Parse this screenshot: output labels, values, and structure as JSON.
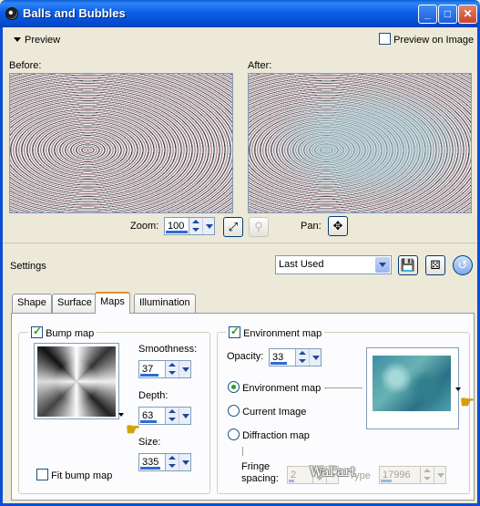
{
  "window": {
    "title": "Balls and Bubbles",
    "minimize": "_",
    "maximize": "□",
    "close": "✕"
  },
  "preview": {
    "toggle_label": "Preview",
    "preview_on_image_label": "Preview on Image",
    "preview_on_image_checked": false,
    "before_label": "Before:",
    "after_label": "After:"
  },
  "zoom": {
    "label": "Zoom:",
    "value": "100",
    "pan_label": "Pan:",
    "fit_icon": "fit-to-window-icon",
    "zoom_icon": "magnifier-icon",
    "pan_icon": "pan-move-icon"
  },
  "settings": {
    "label": "Settings",
    "preset_value": "Last Used",
    "save_icon": "floppy-save-icon",
    "randomize_icon": "dice-randomize-icon",
    "reset_icon": "reset-icon"
  },
  "tabs": [
    {
      "label": "Shape",
      "active": false
    },
    {
      "label": "Surface",
      "active": false
    },
    {
      "label": "Maps",
      "active": true
    },
    {
      "label": "Illumination",
      "active": false
    }
  ],
  "bump": {
    "label": "Bump map",
    "checked": true,
    "smoothness_label": "Smoothness:",
    "smoothness_value": "37",
    "depth_label": "Depth:",
    "depth_value": "63",
    "size_label": "Size:",
    "size_value": "335",
    "fit_label": "Fit bump map",
    "fit_checked": false
  },
  "environment": {
    "label": "Environment map",
    "checked": true,
    "opacity_label": "Opacity:",
    "opacity_value": "33",
    "options": [
      {
        "label": "Environment map",
        "selected": true
      },
      {
        "label": "Current Image",
        "selected": false
      },
      {
        "label": "Diffraction map",
        "selected": false
      }
    ],
    "fringe_label_1": "Fringe",
    "fringe_label_2": "spacing:",
    "fringe_value": "2",
    "type_label": "Type",
    "type_value": "17996"
  },
  "watermark": "Wal'art",
  "colors": {
    "titlebar": "#0b5ee8",
    "accent_tab": "#e68b2c",
    "check": "#21a121"
  }
}
